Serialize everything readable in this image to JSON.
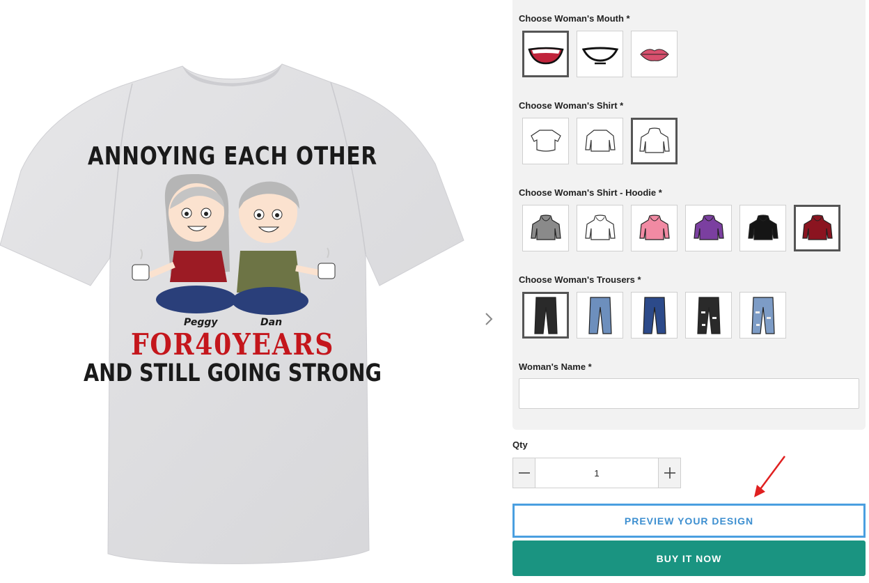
{
  "product": {
    "design_line1": "ANNOYING EACH OTHER",
    "design_line2": "FOR40YEARS",
    "design_line3": "AND STILL GOING STRONG",
    "name_left": "Peggy",
    "name_right": "Dan"
  },
  "options": {
    "mouth": {
      "label": "Choose Woman's Mouth *",
      "selected_index": 0,
      "items": [
        "big-smile-red",
        "grin",
        "lips-pink"
      ]
    },
    "shirt": {
      "label": "Choose Woman's Shirt *",
      "selected_index": 2,
      "items": [
        "crop-top",
        "sweater",
        "hoodie"
      ]
    },
    "hoodie": {
      "label": "Choose Woman's Shirt - Hoodie *",
      "selected_index": 5,
      "items": [
        {
          "name": "gray",
          "color": "#8a8a8a"
        },
        {
          "name": "white",
          "color": "#ffffff"
        },
        {
          "name": "pink",
          "color": "#f18aa3"
        },
        {
          "name": "purple",
          "color": "#7b3fa0"
        },
        {
          "name": "black",
          "color": "#151515"
        },
        {
          "name": "maroon",
          "color": "#8b1420"
        }
      ]
    },
    "trousers": {
      "label": "Choose Woman's Trousers *",
      "selected_index": 0,
      "items": [
        {
          "name": "black",
          "color": "#2a2a2a"
        },
        {
          "name": "light-blue",
          "color": "#6d8fbd"
        },
        {
          "name": "navy",
          "color": "#2c4a8a"
        },
        {
          "name": "black-ripped",
          "color": "#2a2a2a"
        },
        {
          "name": "light-ripped",
          "color": "#7d9cc6"
        }
      ]
    },
    "name": {
      "label": "Woman's Name *",
      "value": "",
      "placeholder": ""
    }
  },
  "qty": {
    "label": "Qty",
    "value": "1"
  },
  "buttons": {
    "preview": "PREVIEW YOUR DESIGN",
    "buy": "BUY IT NOW"
  },
  "colors": {
    "accent_blue": "#4a9fe0",
    "buy_green": "#1a9481",
    "annotation_red": "#e02020"
  }
}
